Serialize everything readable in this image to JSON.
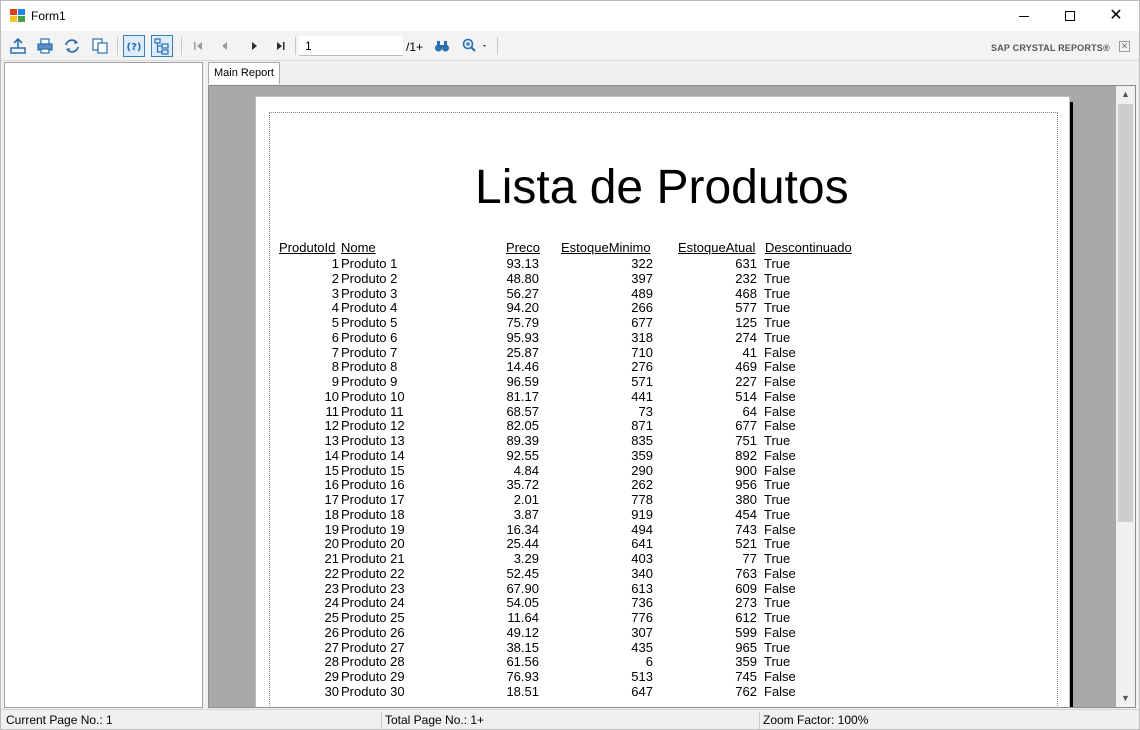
{
  "window": {
    "title": "Form1"
  },
  "toolbar": {
    "page_value": "1",
    "page_total": "/1+",
    "brand": "SAP CRYSTAL REPORTS®"
  },
  "tabs": {
    "main": "Main Report"
  },
  "report": {
    "title": "Lista de Produtos",
    "headers": {
      "id": "ProdutoId",
      "nome": "Nome",
      "preco": "Preco",
      "estoque_minimo": "EstoqueMinimo",
      "estoque_atual": "EstoqueAtual",
      "descontinuado": "Descontinuado"
    },
    "rows": [
      [
        "1",
        "Produto 1",
        "93.13",
        "322",
        "631",
        "True"
      ],
      [
        "2",
        "Produto 2",
        "48.80",
        "397",
        "232",
        "True"
      ],
      [
        "3",
        "Produto 3",
        "56.27",
        "489",
        "468",
        "True"
      ],
      [
        "4",
        "Produto 4",
        "94.20",
        "266",
        "577",
        "True"
      ],
      [
        "5",
        "Produto 5",
        "75.79",
        "677",
        "125",
        "True"
      ],
      [
        "6",
        "Produto 6",
        "95.93",
        "318",
        "274",
        "True"
      ],
      [
        "7",
        "Produto 7",
        "25.87",
        "710",
        "41",
        "False"
      ],
      [
        "8",
        "Produto 8",
        "14.46",
        "276",
        "469",
        "False"
      ],
      [
        "9",
        "Produto 9",
        "96.59",
        "571",
        "227",
        "False"
      ],
      [
        "10",
        "Produto 10",
        "81.17",
        "441",
        "514",
        "False"
      ],
      [
        "11",
        "Produto 11",
        "68.57",
        "73",
        "64",
        "False"
      ],
      [
        "12",
        "Produto 12",
        "82.05",
        "871",
        "677",
        "False"
      ],
      [
        "13",
        "Produto 13",
        "89.39",
        "835",
        "751",
        "True"
      ],
      [
        "14",
        "Produto 14",
        "92.55",
        "359",
        "892",
        "False"
      ],
      [
        "15",
        "Produto 15",
        "4.84",
        "290",
        "900",
        "False"
      ],
      [
        "16",
        "Produto 16",
        "35.72",
        "262",
        "956",
        "True"
      ],
      [
        "17",
        "Produto 17",
        "2.01",
        "778",
        "380",
        "True"
      ],
      [
        "18",
        "Produto 18",
        "3.87",
        "919",
        "454",
        "True"
      ],
      [
        "19",
        "Produto 19",
        "16.34",
        "494",
        "743",
        "False"
      ],
      [
        "20",
        "Produto 20",
        "25.44",
        "641",
        "521",
        "True"
      ],
      [
        "21",
        "Produto 21",
        "3.29",
        "403",
        "77",
        "True"
      ],
      [
        "22",
        "Produto 22",
        "52.45",
        "340",
        "763",
        "False"
      ],
      [
        "23",
        "Produto 23",
        "67.90",
        "613",
        "609",
        "False"
      ],
      [
        "24",
        "Produto 24",
        "54.05",
        "736",
        "273",
        "True"
      ],
      [
        "25",
        "Produto 25",
        "11.64",
        "776",
        "612",
        "True"
      ],
      [
        "26",
        "Produto 26",
        "49.12",
        "307",
        "599",
        "False"
      ],
      [
        "27",
        "Produto 27",
        "38.15",
        "435",
        "965",
        "True"
      ],
      [
        "28",
        "Produto 28",
        "61.56",
        "6",
        "359",
        "True"
      ],
      [
        "29",
        "Produto 29",
        "76.93",
        "513",
        "745",
        "False"
      ],
      [
        "30",
        "Produto 30",
        "18.51",
        "647",
        "762",
        "False"
      ]
    ]
  },
  "status": {
    "current_page": "Current Page No.: 1",
    "total_page": "Total Page No.: 1+",
    "zoom": "Zoom Factor: 100%"
  },
  "icons": [
    "export-icon",
    "print-icon",
    "refresh-icon",
    "copy-icon",
    "help-icon",
    "group-tree-icon",
    "first-page-icon",
    "previous-page-icon",
    "next-page-icon",
    "last-page-icon",
    "find-icon",
    "zoom-icon"
  ]
}
